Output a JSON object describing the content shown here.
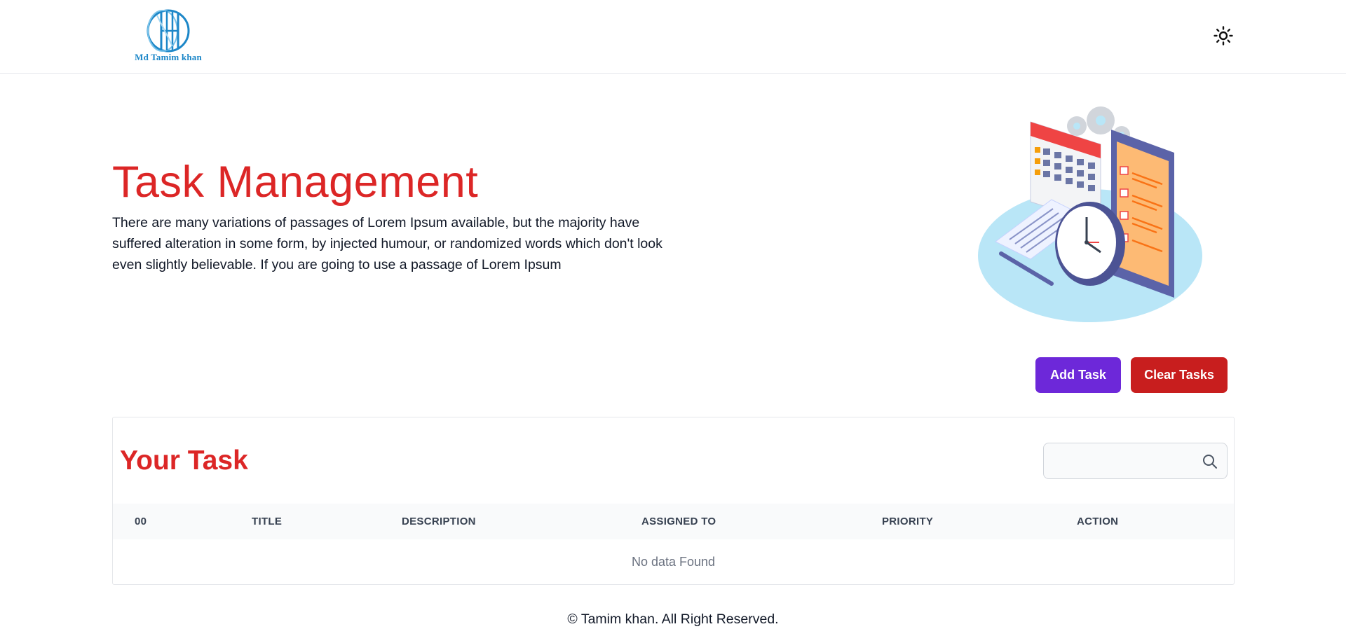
{
  "header": {
    "logo_text": "Md Tamim khan",
    "theme_toggle_icon": "sun-icon"
  },
  "hero": {
    "title": "Task Management",
    "description": "There are many variations of passages of Lorem Ipsum available, but the majority have suffered alteration in some form, by injected humour, or randomized words which don't look even slightly believable. If you are going to use a passage of Lorem Ipsum"
  },
  "actions": {
    "add_label": "Add Task",
    "clear_label": "Clear Tasks"
  },
  "tasks": {
    "heading": "Your Task",
    "search_placeholder": "",
    "search_icon": "search-icon",
    "columns": [
      "00",
      "TITLE",
      "DESCRIPTION",
      "ASSIGNED TO",
      "PRIORITY",
      "ACTION"
    ],
    "empty_message": "No data Found"
  },
  "footer": {
    "text": "© Tamim khan. All Right Reserved."
  },
  "colors": {
    "accent_red": "#dc2626",
    "add_button": "#6d28d9",
    "clear_button": "#c81e1e"
  }
}
